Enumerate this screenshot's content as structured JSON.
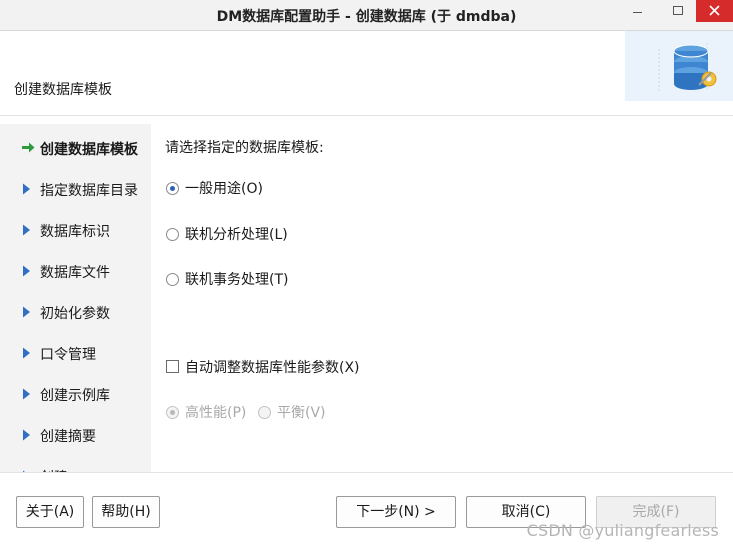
{
  "window": {
    "title": "DM数据库配置助手 - 创建数据库 (于 dmdba)"
  },
  "header": {
    "label": "创建数据库模板",
    "logo_icon": "database-gear-icon"
  },
  "nav": {
    "items": [
      {
        "label": "创建数据库模板",
        "active": true
      },
      {
        "label": "指定数据库目录",
        "active": false
      },
      {
        "label": "数据库标识",
        "active": false
      },
      {
        "label": "数据库文件",
        "active": false
      },
      {
        "label": "初始化参数",
        "active": false
      },
      {
        "label": "口令管理",
        "active": false
      },
      {
        "label": "创建示例库",
        "active": false
      },
      {
        "label": "创建摘要",
        "active": false
      },
      {
        "label": "创建",
        "active": false
      }
    ]
  },
  "content": {
    "prompt": "请选择指定的数据库模板:",
    "templates": [
      {
        "label": "一般用途(O)",
        "selected": true
      },
      {
        "label": "联机分析处理(L)",
        "selected": false
      },
      {
        "label": "联机事务处理(T)",
        "selected": false
      }
    ],
    "auto_tune": {
      "label": "自动调整数据库性能参数(X)",
      "checked": false
    },
    "perf_modes": [
      {
        "label": "高性能(P)",
        "selected": true
      },
      {
        "label": "平衡(V)",
        "selected": false
      }
    ]
  },
  "footer": {
    "about": "关于(A)",
    "help": "帮助(H)",
    "next": "下一步(N) >",
    "cancel": "取消(C)",
    "finish": "完成(F)"
  },
  "watermark": "CSDN @yuliangfearless",
  "colors": {
    "accent_arrow": "#2e9a3e",
    "nav_triangle": "#2f6fc4",
    "close_button": "#d52b2b"
  }
}
